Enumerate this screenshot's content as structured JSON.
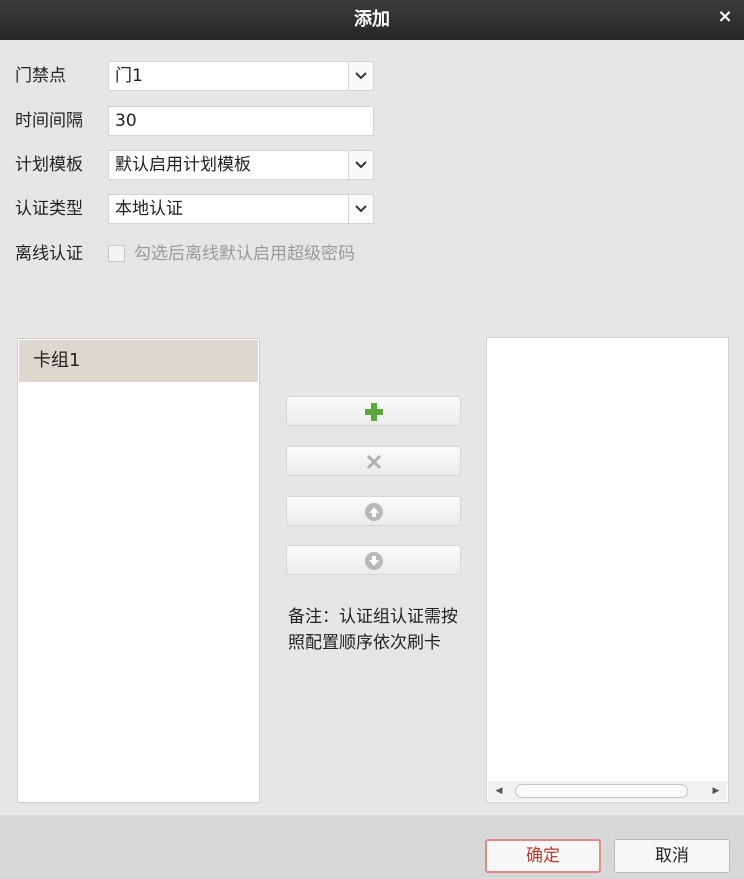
{
  "window": {
    "title": "添加",
    "close_symbol": "×"
  },
  "form": {
    "door": {
      "label": "门禁点",
      "value": "门1"
    },
    "interval": {
      "label": "时间间隔",
      "value": "30"
    },
    "schedule": {
      "label": "计划模板",
      "value": "默认启用计划模板"
    },
    "auth_type": {
      "label": "认证类型",
      "value": "本地认证"
    },
    "offline": {
      "label": "离线认证",
      "checkbox_text": "勾选后离线默认启用超级密码",
      "checked": false,
      "enabled": false
    }
  },
  "card_groups": {
    "items": [
      "卡组1"
    ],
    "selected_index": 0
  },
  "actions": {
    "add_icon": "plus-icon",
    "add_color": "#5aa83c",
    "remove_icon": "close-icon",
    "up_icon": "arrow-up-circle-icon",
    "down_icon": "arrow-down-circle-icon"
  },
  "note": "备注：认证组认证需按照配置顺序依次刷卡",
  "scrollbar": {
    "left_arrow": "◀",
    "right_arrow": "▶"
  },
  "footer": {
    "ok_label": "确定",
    "cancel_label": "取消",
    "ok_accent": "#e08a8a"
  }
}
